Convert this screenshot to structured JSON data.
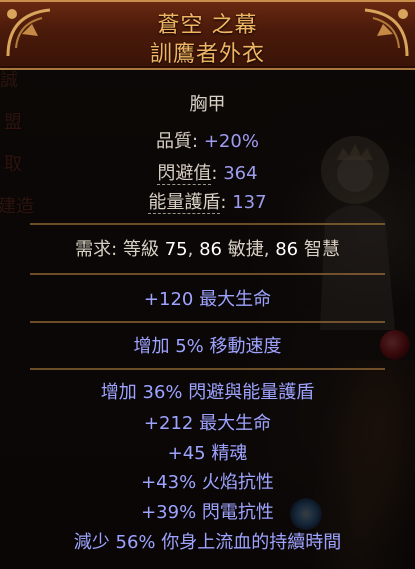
{
  "left_menu": [
    "誠",
    "盟",
    "取",
    "建造"
  ],
  "item": {
    "name": "蒼空 之幕",
    "base": "訓鷹者外衣",
    "item_class": "胸甲",
    "properties": [
      {
        "label": "品質",
        "sep": ": ",
        "value": "+20%"
      },
      {
        "label": "閃避值",
        "sep": ": ",
        "value": "364"
      },
      {
        "label": "能量護盾",
        "sep": ": ",
        "value": "137"
      }
    ],
    "requirements": {
      "label": "需求",
      "sep": ": ",
      "level_label": "等級",
      "level": "75",
      "dex": "86",
      "dex_label": "敏捷",
      "int": "86",
      "int_label": "智慧"
    },
    "implicit": "+120 最大生命",
    "enchant": "增加 5% 移動速度",
    "mods": [
      "增加 36% 閃避與能量護盾",
      "+212 最大生命",
      "+45 精魂",
      "+43% 火焰抗性",
      "+39% 閃電抗性",
      "減少 56% 你身上流血的持續時間"
    ]
  },
  "colors": {
    "unique_name": "#f0b563",
    "magic_mod": "#9ea3ff",
    "header_bg": "#4a1a0a",
    "separator": "#a8773b"
  }
}
